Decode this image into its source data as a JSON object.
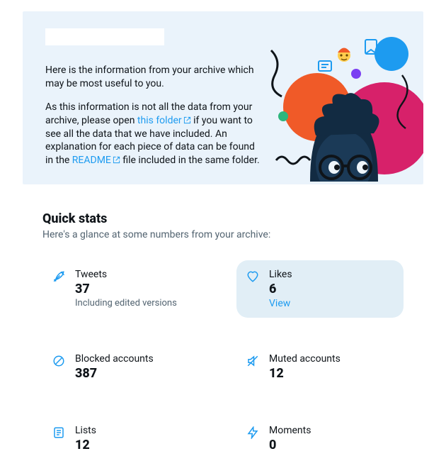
{
  "hero": {
    "p1": "Here is the information from your archive which may be most useful to you.",
    "p2a": "As this information is not all the data from your archive, please open ",
    "link_folder": "this folder",
    "p2b": " if you want to see all the data that we have included. An explanation for each piece of data can be found in the ",
    "link_readme": "README",
    "p2c": " file included in the same folder."
  },
  "quick": {
    "title": "Quick stats",
    "subtitle": "Here's a glance at some numbers from your archive:"
  },
  "stats": {
    "tweets": {
      "label": "Tweets",
      "value": "37",
      "note": "Including edited versions"
    },
    "likes": {
      "label": "Likes",
      "value": "6",
      "view": "View"
    },
    "blocked": {
      "label": "Blocked accounts",
      "value": "387"
    },
    "muted": {
      "label": "Muted accounts",
      "value": "12"
    },
    "lists": {
      "label": "Lists",
      "value": "12"
    },
    "moments": {
      "label": "Moments",
      "value": "0"
    }
  }
}
